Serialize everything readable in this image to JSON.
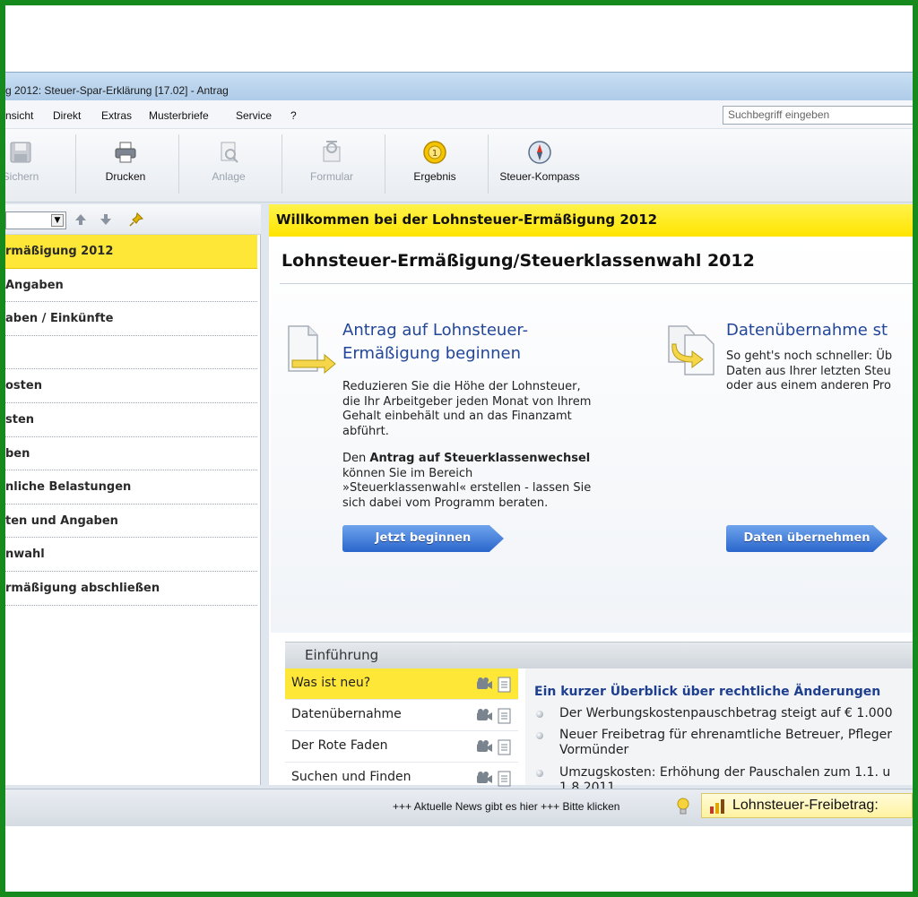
{
  "window": {
    "title": "g 2012: Steuer-Spar-Erklärung [17.02] - Antrag"
  },
  "menu": {
    "items": [
      "nsicht",
      "Direkt",
      "Extras",
      "Musterbriefe",
      "Service",
      "?"
    ],
    "search_placeholder": "Suchbegriff eingeben"
  },
  "toolbar": {
    "buttons": [
      {
        "label": "Sichern",
        "icon": "floppy-disk-icon",
        "enabled": false
      },
      {
        "label": "Drucken",
        "icon": "printer-icon",
        "enabled": true
      },
      {
        "label": "Anlage",
        "icon": "attachment-icon",
        "enabled": false
      },
      {
        "label": "Formular",
        "icon": "form-icon",
        "enabled": false
      },
      {
        "label": "Ergebnis",
        "icon": "result-icon",
        "enabled": true
      },
      {
        "label": "Steuer-Kompass",
        "icon": "compass-icon",
        "enabled": true
      }
    ]
  },
  "sidebar": {
    "items": [
      {
        "label": "rmäßigung 2012",
        "active": true
      },
      {
        "label": "Angaben",
        "active": false
      },
      {
        "label": "aben / Einkünfte",
        "active": false
      },
      {
        "label": "",
        "active": false
      },
      {
        "label": "osten",
        "active": false
      },
      {
        "label": "sten",
        "active": false
      },
      {
        "label": "ben",
        "active": false
      },
      {
        "label": "nliche Belastungen",
        "active": false
      },
      {
        "label": "ten und Angaben",
        "active": false
      },
      {
        "label": "nwahl",
        "active": false
      },
      {
        "label": "rmäßigung abschließen",
        "active": false
      }
    ]
  },
  "main": {
    "welcome": "Willkommen bei der Lohnsteuer-Ermäßigung 2012",
    "title": "Lohnsteuer-Ermäßigung/Steuerklassenwahl 2012",
    "card_left": {
      "title_line1": "Antrag auf Lohnsteuer-",
      "title_line2": "Ermäßigung beginnen",
      "text1": "Reduzieren Sie die Höhe der Lohnsteuer,\ndie Ihr Arbeitgeber jeden Monat von Ihrem\nGehalt einbehält und an das Finanzamt\nabführt.",
      "text2_pre": "Den ",
      "text2_bold": "Antrag auf Steuerklassenwechsel",
      "text2_post": "\nkönnen Sie im Bereich\n»Steuerklassenwahl« erstellen - lassen Sie\nsich dabei vom Programm beraten.",
      "button": "Jetzt beginnen"
    },
    "card_right": {
      "title": "Datenübernahme st",
      "text": "So geht's noch schneller: Üb\nDaten aus Ihrer letzten Steu\noder aus einem anderen Pro",
      "button": "Daten übernehmen"
    }
  },
  "intro": {
    "header": "Einführung",
    "items": [
      {
        "label": "Was ist neu?",
        "active": true
      },
      {
        "label": "Datenübernahme",
        "active": false
      },
      {
        "label": "Der Rote Faden",
        "active": false
      },
      {
        "label": "Suchen und Finden",
        "active": false
      }
    ],
    "news_title": "Ein kurzer Überblick über rechtliche Änderungen",
    "news": [
      "Der Werbungskostenpauschbetrag steigt auf € 1.000",
      "Neuer Freibetrag für ehrenamtliche Betreuer, Pfleger\nVormünder",
      "Umzugskosten: Erhöhung der Pauschalen zum 1.1. u\n1.8.2011"
    ]
  },
  "status": {
    "news": "+++ Aktuelle News gibt es hier +++ Bitte klicken",
    "freibetrag_label": "Lohnsteuer-Freibetrag:"
  },
  "colors": {
    "frame": "#178a1e",
    "highlight_yellow": "#ffe737",
    "link_blue": "#21469a",
    "button_blue": "#2a66cc"
  }
}
